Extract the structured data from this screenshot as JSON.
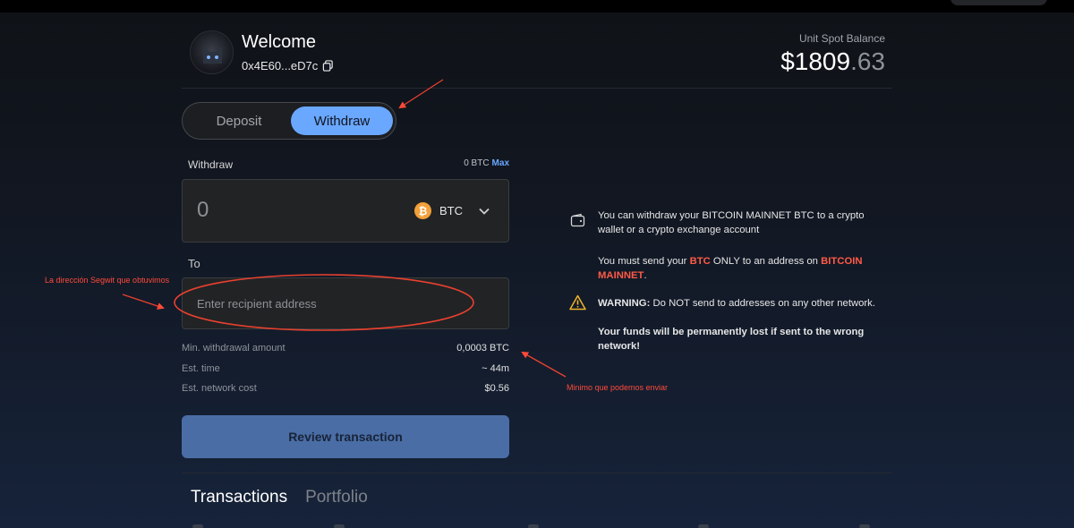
{
  "header": {
    "welcome": "Welcome",
    "address": "0x4E60...eD7c",
    "balance_label": "Unit Spot Balance",
    "balance_whole": "$1809",
    "balance_cents": ".63"
  },
  "toggle": {
    "deposit": "Deposit",
    "withdraw": "Withdraw",
    "active": "Withdraw"
  },
  "withdraw": {
    "label": "Withdraw",
    "available": "0 BTC",
    "max": "Max",
    "amount": "0",
    "coin": "BTC",
    "to_label": "To",
    "to_placeholder": "Enter recipient address"
  },
  "details": [
    {
      "label": "Min. withdrawal amount",
      "value": "0,0003 BTC"
    },
    {
      "label": "Est. time",
      "value": "~ 44m"
    },
    {
      "label": "Est. network cost",
      "value": "$0.56"
    }
  ],
  "review_button": "Review transaction",
  "bottom_tabs": [
    "Transactions",
    "Portfolio"
  ],
  "notice": {
    "line1": "You can withdraw your BITCOIN MAINNET BTC to a crypto wallet or a crypto exchange account",
    "send_a": "You must send your ",
    "send_btc": "BTC",
    "send_b": " ONLY to an address on ",
    "send_network": "BITCOIN MAINNET",
    "send_c": ".",
    "warning_bold": "WARNING:",
    "warning_text": " Do NOT send to addresses on any other network.",
    "loss": "Your funds will be permanently lost if sent to the wrong network!"
  },
  "annotations": {
    "segwit": "La dirección Segwit que obtuvimos",
    "minimum": "Minimo que podemos enviar"
  },
  "colors": {
    "accent": "#6aa7ff",
    "warning_red": "#ff5a46",
    "btc_orange": "#f2a03a",
    "annotation_red": "#ff4a3a"
  },
  "icons": [
    "copy-icon",
    "bitcoin-icon",
    "chevron-down-icon",
    "wallet-icon",
    "warning-icon"
  ]
}
